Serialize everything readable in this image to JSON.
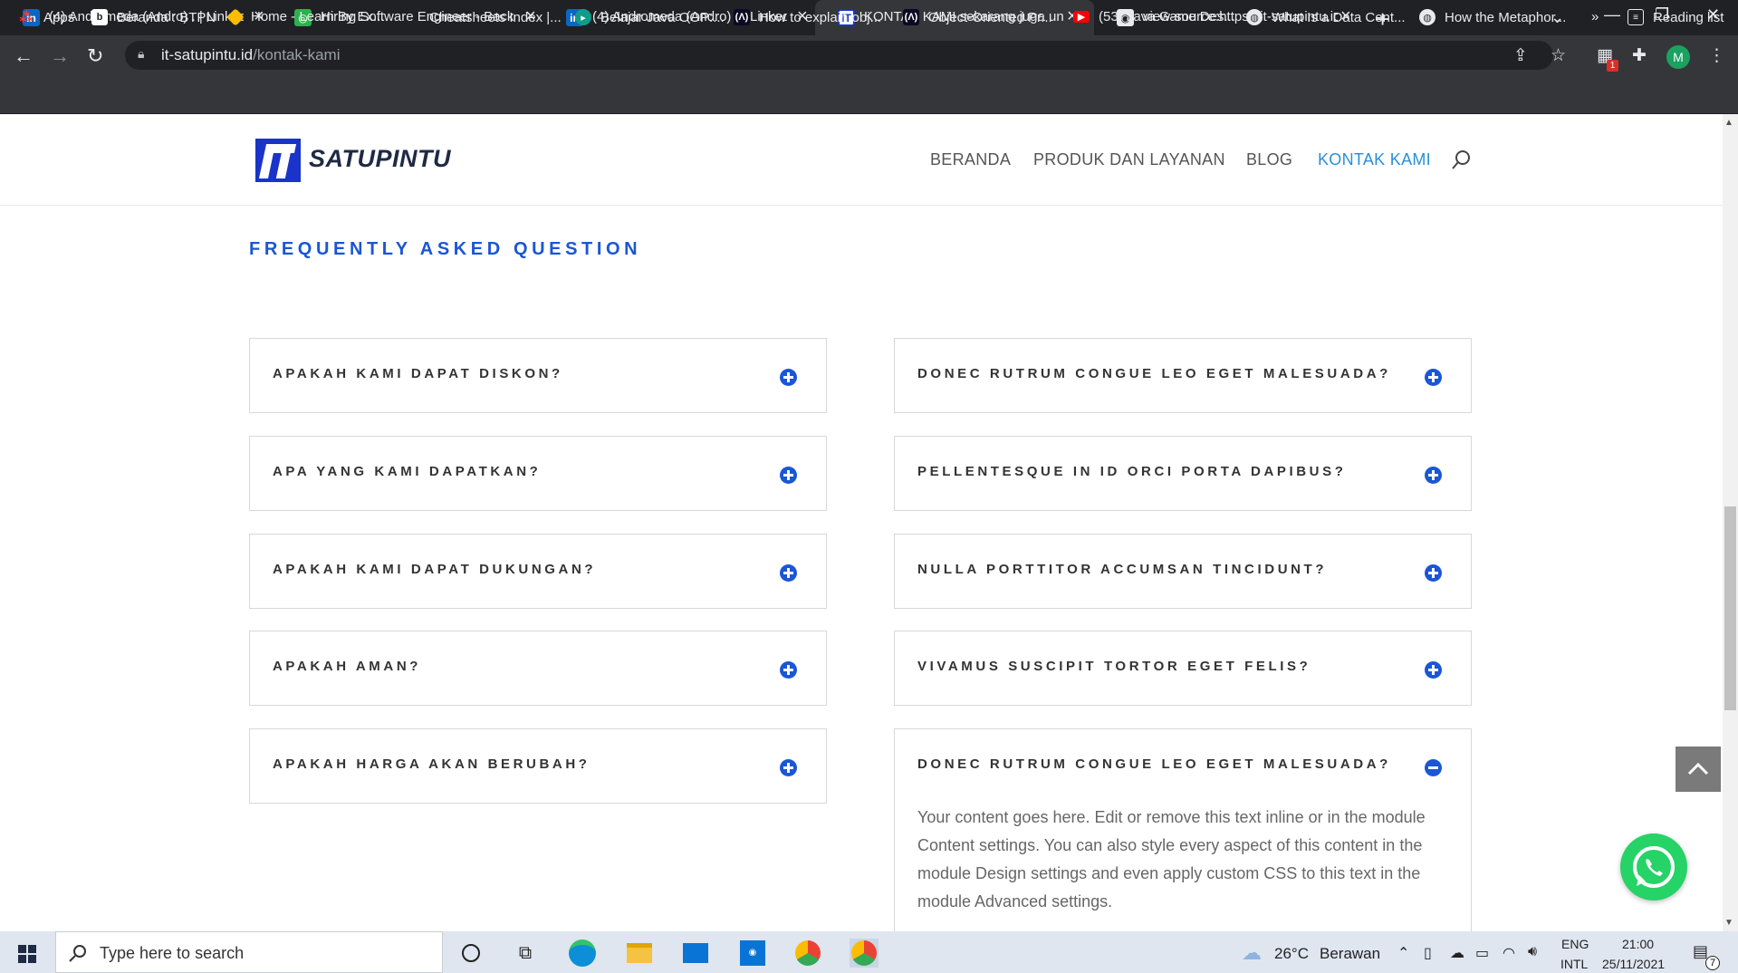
{
  "browser": {
    "tabs": [
      {
        "title": "(4) Andromeda (Andro) . | LinkedIn",
        "favicon": "linkedin-icon",
        "active": false
      },
      {
        "title": "Hiring Software Engineer - Backend",
        "favicon": "hiring-icon",
        "active": false
      },
      {
        "title": "(4) Andromeda (Andro) . | LinkedIn",
        "favicon": "linkedin-icon",
        "active": false
      },
      {
        "title": "KONTAK KAMI sekarang juga untuk",
        "favicon": "it-satupintu-icon",
        "active": true
      },
      {
        "title": "view-source:https://it-satupintu.id",
        "favicon": "globe-icon",
        "active": false
      }
    ],
    "url_host": "it-satupintu.id",
    "url_path": "/kontak-kami",
    "profile_initial": "M",
    "extension_badge": "1",
    "bookmarks": [
      {
        "label": "Apps",
        "icon": "apps-grid-icon"
      },
      {
        "label": "Beranda : BTPN",
        "icon": "b-icon"
      },
      {
        "label": "Home - Learn By Ex...",
        "icon": "diamond-icon"
      },
      {
        "label": "Cheatsheets Index |...",
        "icon": "blank-icon"
      },
      {
        "label": "Belajar Java OOP:...",
        "icon": "teal-icon"
      },
      {
        "label": "How to explain obj...",
        "icon": "freecodecamp-icon"
      },
      {
        "label": "Object-Oriented Pr...",
        "icon": "freecodecamp-icon"
      },
      {
        "label": "(53) Java Game Des...",
        "icon": "youtube-icon"
      },
      {
        "label": "What Is a Data Cent...",
        "icon": "globe-icon"
      },
      {
        "label": "How the Metaphor...",
        "icon": "globe-icon"
      }
    ],
    "bookmarks_more": "»",
    "reading_list": "Reading list"
  },
  "site": {
    "logo_text": "SATUPINTU",
    "nav": [
      {
        "label": "BERANDA",
        "active": false
      },
      {
        "label": "PRODUK DAN LAYANAN",
        "active": false
      },
      {
        "label": "BLOG",
        "active": false
      },
      {
        "label": "KONTAK KAMI",
        "active": true
      }
    ],
    "accent_color": "#1a56d6",
    "nav_active_color": "#2b8fd6"
  },
  "faq": {
    "title": "FREQUENTLY ASKED QUESTION",
    "left": [
      {
        "question": "APAKAH KAMI DAPAT DISKON?",
        "open": false
      },
      {
        "question": "APA YANG KAMI DAPATKAN?",
        "open": false
      },
      {
        "question": "APAKAH KAMI DAPAT DUKUNGAN?",
        "open": false
      },
      {
        "question": "APAKAH AMAN?",
        "open": false
      },
      {
        "question": "APAKAH HARGA AKAN BERUBAH?",
        "open": false
      }
    ],
    "right": [
      {
        "question": "DONEC RUTRUM CONGUE LEO EGET MALESUADA?",
        "open": false
      },
      {
        "question": "PELLENTESQUE IN ID ORCI PORTA DAPIBUS?",
        "open": false
      },
      {
        "question": "NULLA PORTTITOR ACCUMSAN TINCIDUNT?",
        "open": false
      },
      {
        "question": "VIVAMUS SUSCIPIT TORTOR EGET FELIS?",
        "open": false
      },
      {
        "question": "DONEC RUTRUM CONGUE LEO EGET MALESUADA?",
        "open": true,
        "answer": "Your content goes here. Edit or remove this text inline or in the module Content settings. You can also style every aspect of this content in the module Design settings and even apply custom CSS to this text in the module Advanced settings."
      }
    ]
  },
  "taskbar": {
    "search_placeholder": "Type here to search",
    "weather_temp": "26°C",
    "weather_desc": "Berawan",
    "lang_primary": "ENG",
    "lang_secondary": "INTL",
    "time": "21:00",
    "date": "25/11/2021",
    "notification_count": "7"
  }
}
